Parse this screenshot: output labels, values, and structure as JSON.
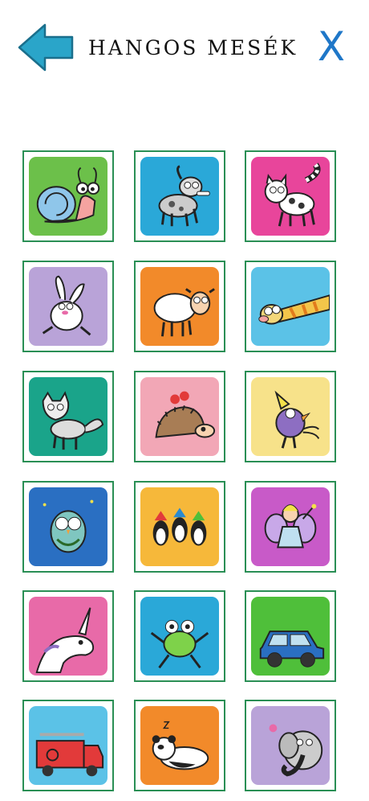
{
  "header": {
    "title": "HANGOS MESÉK",
    "back_icon": "arrow-left-icon",
    "close_label": "X",
    "accent_color": "#1f77c8",
    "arrow_color": "#2aa5c9"
  },
  "tiles": [
    {
      "name": "snail",
      "icon": "snail-icon",
      "bg": "#6cc04a"
    },
    {
      "name": "dog",
      "icon": "dog-icon",
      "bg": "#2aa8d8"
    },
    {
      "name": "cat",
      "icon": "cat-icon",
      "bg": "#e8459b"
    },
    {
      "name": "rabbit",
      "icon": "rabbit-icon",
      "bg": "#b9a3d8"
    },
    {
      "name": "sheep",
      "icon": "sheep-icon",
      "bg": "#f28a2a"
    },
    {
      "name": "giraffe",
      "icon": "giraffe-icon",
      "bg": "#5bc2e7"
    },
    {
      "name": "wolf",
      "icon": "wolf-icon",
      "bg": "#1aa48a"
    },
    {
      "name": "hedgehog",
      "icon": "hedgehog-icon",
      "bg": "#f2a7b6"
    },
    {
      "name": "bird",
      "icon": "bird-icon",
      "bg": "#f7e28a"
    },
    {
      "name": "owl",
      "icon": "owl-icon",
      "bg": "#2a6fc2"
    },
    {
      "name": "penguins",
      "icon": "penguins-icon",
      "bg": "#f6b83a"
    },
    {
      "name": "fairy",
      "icon": "fairy-icon",
      "bg": "#c85ac8"
    },
    {
      "name": "unicorn",
      "icon": "unicorn-icon",
      "bg": "#e86aa8"
    },
    {
      "name": "frog",
      "icon": "frog-icon",
      "bg": "#2aa8d8"
    },
    {
      "name": "car",
      "icon": "car-icon",
      "bg": "#4fbf3a"
    },
    {
      "name": "fire-truck",
      "icon": "fire-truck-icon",
      "bg": "#5bc2e7"
    },
    {
      "name": "panda",
      "icon": "panda-icon",
      "bg": "#f28a2a"
    },
    {
      "name": "elephant",
      "icon": "elephant-icon",
      "bg": "#b9a3d8"
    }
  ]
}
